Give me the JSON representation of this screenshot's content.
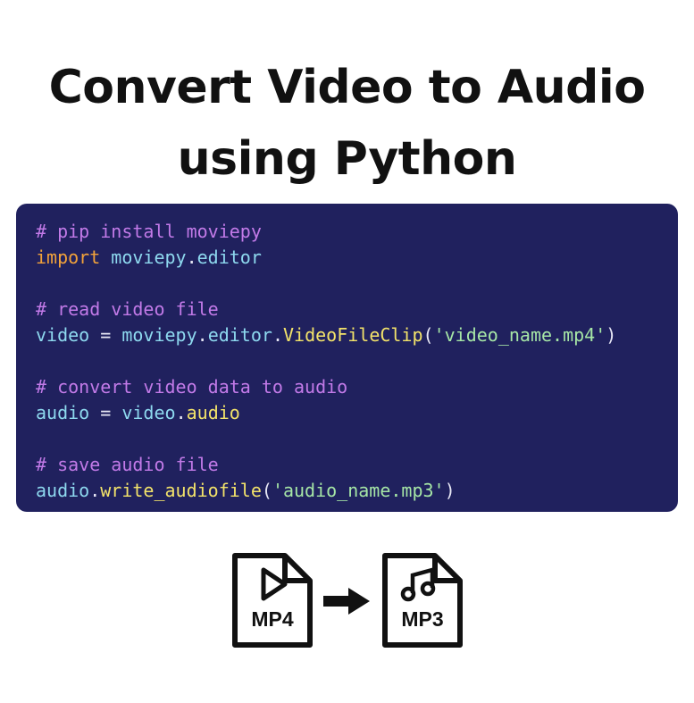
{
  "title": {
    "line1": "Convert Video to Audio",
    "line2": "using Python"
  },
  "code": {
    "line1_comment": "# pip install moviepy",
    "line2_keyword": "import",
    "line2_module": "moviepy",
    "line2_dot": ".",
    "line2_attr": "editor",
    "line4_comment": "# read video file",
    "line5_var": "video",
    "line5_eq": " = ",
    "line5_module": "moviepy",
    "line5_dot1": ".",
    "line5_attr": "editor",
    "line5_dot2": ".",
    "line5_func": "VideoFileClip",
    "line5_open": "(",
    "line5_string": "'video_name.mp4'",
    "line5_close": ")",
    "line7_comment": "# convert video data to audio",
    "line8_var": "audio",
    "line8_eq": " = ",
    "line8_obj": "video",
    "line8_dot": ".",
    "line8_attr": "audio",
    "line10_comment": "# save audio file",
    "line11_var": "audio",
    "line11_dot": ".",
    "line11_func": "write_audiofile",
    "line11_open": "(",
    "line11_string": "'audio_name.mp3'",
    "line11_close": ")"
  },
  "colors": {
    "code_background": "#20215e",
    "comment": "#c27ae8",
    "keyword": "#f2a23a",
    "identifier": "#8ed9ef",
    "attribute": "#f3e36a",
    "string": "#a6e6a6"
  },
  "icons": {
    "source_icon": "video-play-icon",
    "source_label": "MP4",
    "arrow_icon": "arrow-right-icon",
    "target_icon": "music-note-icon",
    "target_label": "MP3"
  }
}
